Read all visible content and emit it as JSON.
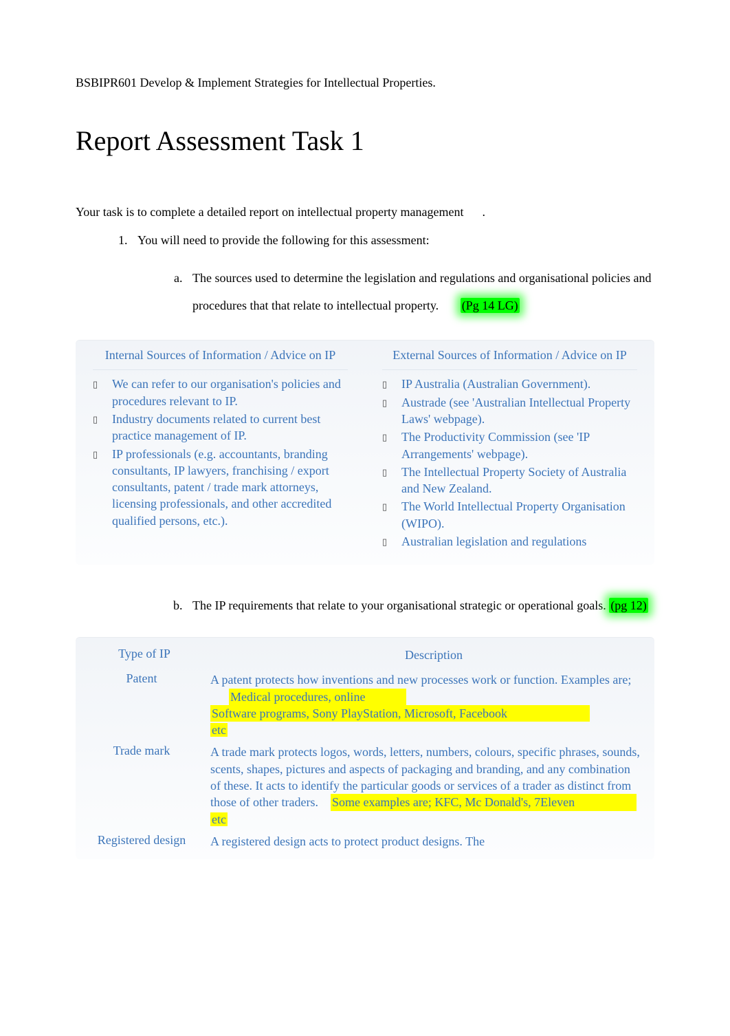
{
  "header": "BSBIPR601 Develop & Implement Strategies for Intellectual Properties.",
  "title": "Report Assessment Task 1",
  "intro_prefix": "Your task is to complete a detailed report on intellectual property management",
  "intro_suffix": ".",
  "ol1_item": "You will need to provide the following for this assessment:",
  "item_a": {
    "text_before": "The sources used to determine the legislation and regulations and organisational policies and procedures that that relate to intellectual property. ",
    "highlight": "(Pg 14 LG)"
  },
  "two_col": {
    "left_header": "Internal Sources of Information / Advice on IP",
    "right_header": "External Sources of Information / Advice on IP",
    "left_items": [
      "We can refer to our organisation's policies and procedures relevant to IP.",
      "Industry documents related to current best practice management of IP.",
      "IP professionals (e.g.  accountants, branding consultants, IP lawyers, franchising / export consultants, patent / trade mark attorneys, licensing professionals, and other accredited qualified persons, etc.)."
    ],
    "right_items": [
      "IP Australia (Australian Government).",
      "Austrade (see 'Australian Intellectual Property Laws' webpage).",
      "The Productivity Commission (see 'IP Arrangements' webpage).",
      "The Intellectual Property Society of Australia and New Zealand.",
      "The World Intellectual Property Organisation (WIPO).",
      "Australian legislation and regulations"
    ]
  },
  "item_b": {
    "text_before": "The IP requirements that relate to your organisational strategic or operational goals. ",
    "highlight": "(pg 12)"
  },
  "ip_table": {
    "headers": {
      "type": "Type of IP",
      "desc": "Description"
    },
    "rows": [
      {
        "type": "Patent",
        "desc_plain": "A patent protects how inventions and new processes work or function. Examples are; ",
        "desc_hl1": "Medical procedures, online",
        "desc_hl_line": "Software programs, Sony PlayStation, Microsoft, Facebook",
        "desc_hl2": "etc"
      },
      {
        "type": "Trade mark",
        "desc_plain": "A trade mark protects logos, words, letters, numbers, colours, specific phrases, sounds, scents, shapes, pictures and aspects of packaging and branding, and any combination of these. It acts to identify the particular goods or services of a trader as distinct from those of other traders. ",
        "desc_hl1": "Some examples are; KFC, Mc Donald's, 7Eleven",
        "desc_hl_line": "",
        "desc_hl2": "etc"
      },
      {
        "type": "Registered design",
        "desc_plain": "A registered design acts to protect product designs. The",
        "desc_hl1": "",
        "desc_hl_line": "",
        "desc_hl2": ""
      }
    ]
  }
}
